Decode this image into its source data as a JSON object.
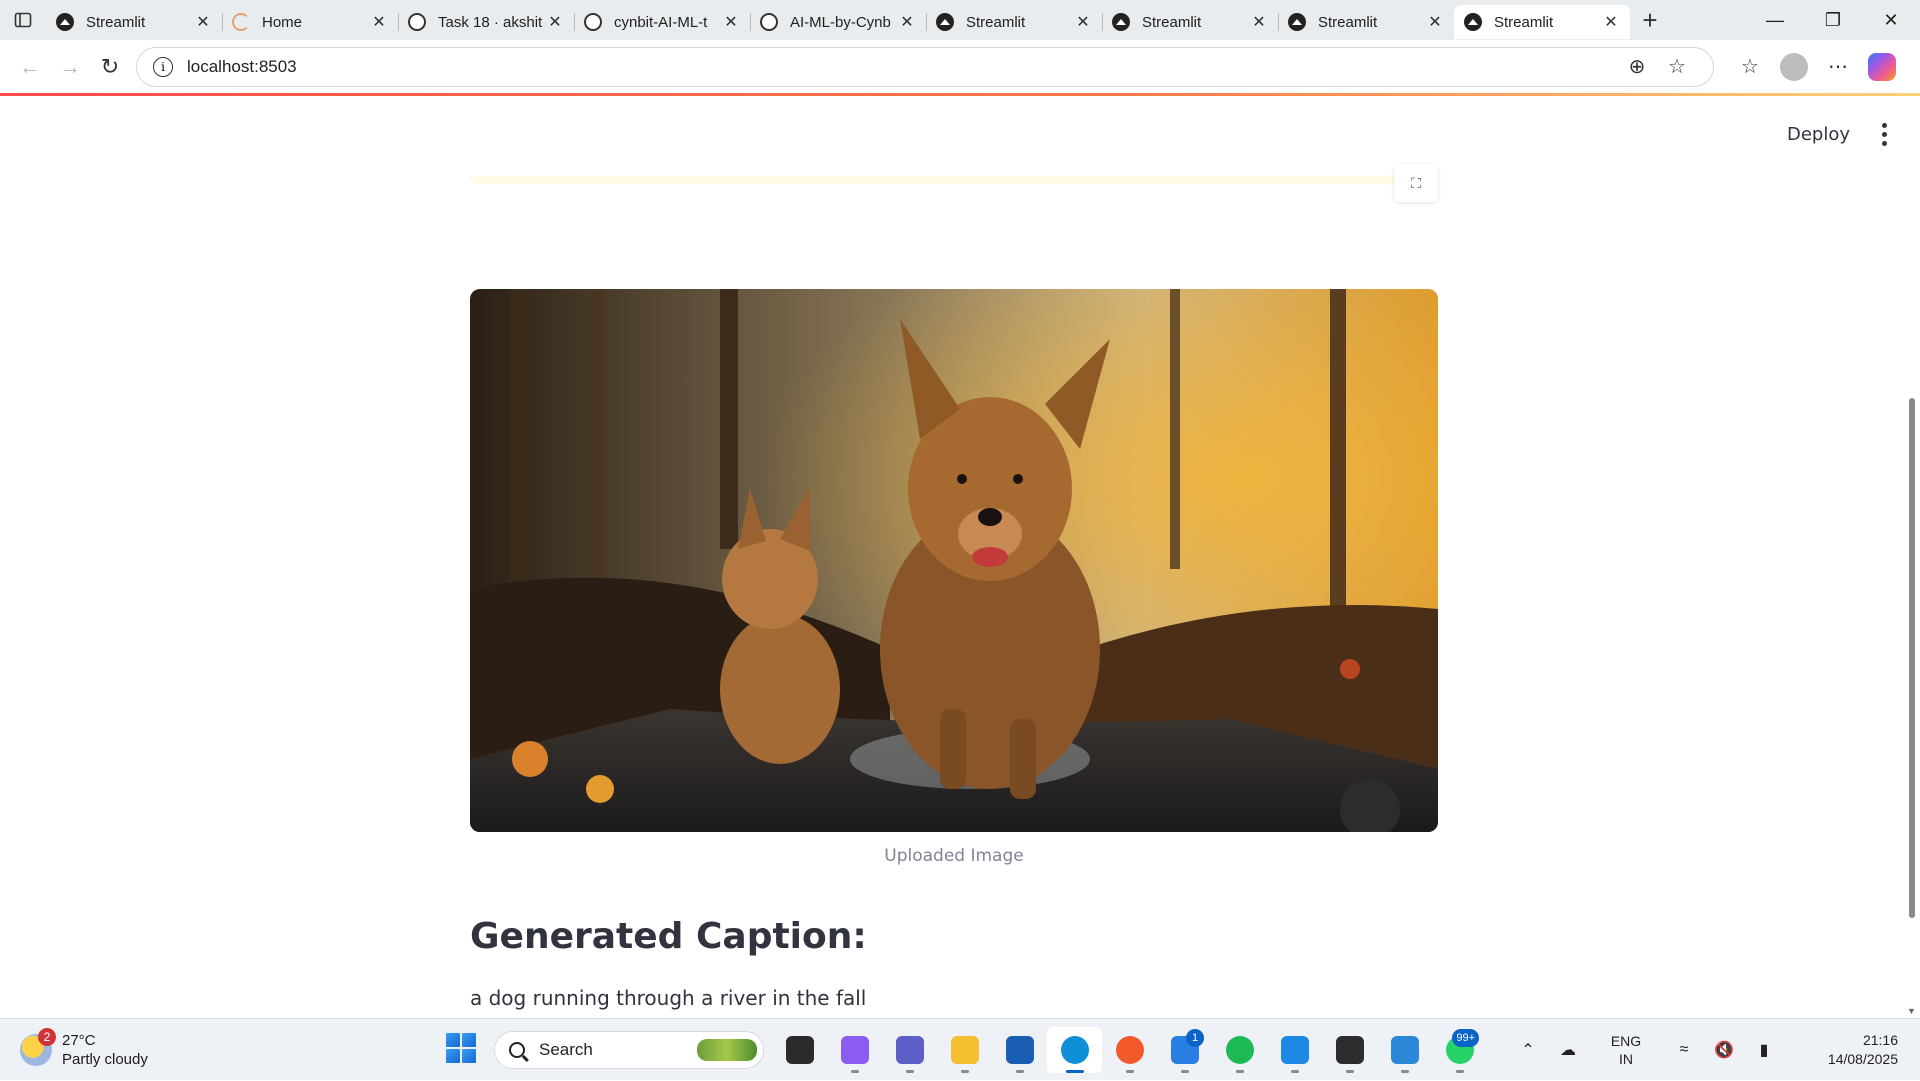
{
  "browser": {
    "tabs": [
      {
        "title": "Streamlit",
        "favicon": "streamlit-icon",
        "active": false
      },
      {
        "title": "Home",
        "favicon": "loading-spinner-icon",
        "active": false
      },
      {
        "title": "Task 18 · akshit",
        "favicon": "github-icon",
        "active": false
      },
      {
        "title": "cynbit-AI-ML-t",
        "favicon": "github-icon",
        "active": false
      },
      {
        "title": "AI-ML-by-Cynb",
        "favicon": "github-icon",
        "active": false
      },
      {
        "title": "Streamlit",
        "favicon": "streamlit-icon",
        "active": false
      },
      {
        "title": "Streamlit",
        "favicon": "streamlit-icon",
        "active": false
      },
      {
        "title": "Streamlit",
        "favicon": "streamlit-icon",
        "active": false
      },
      {
        "title": "Streamlit",
        "favicon": "streamlit-icon",
        "active": true
      }
    ],
    "url": "localhost:8503",
    "progress_color": "#ff4b4b"
  },
  "app": {
    "deploy_label": "Deploy",
    "image_caption": "Uploaded Image",
    "heading": "Generated Caption:",
    "caption_text": "a dog running through a river in the fall",
    "text_color": "#31333f"
  },
  "taskbar": {
    "weather": {
      "badge": "2",
      "temp": "27°C",
      "condition": "Partly cloudy"
    },
    "search_placeholder": "Search",
    "apps": [
      {
        "name": "task-view-icon",
        "color": "#2b2b2b",
        "badge": ""
      },
      {
        "name": "copilot-icon",
        "color": "#8a5cf0",
        "badge": ""
      },
      {
        "name": "teams-icon",
        "color": "#5b5fc7",
        "badge": ""
      },
      {
        "name": "file-explorer-icon",
        "color": "#f4c030",
        "badge": ""
      },
      {
        "name": "store-icon",
        "color": "#1a5fb4",
        "badge": ""
      },
      {
        "name": "edge-icon",
        "color": "#0f8fd8",
        "badge": "",
        "active": true
      },
      {
        "name": "brave-icon",
        "color": "#f25a2b",
        "badge": ""
      },
      {
        "name": "todo-icon",
        "color": "#2a7de1",
        "badge": "1"
      },
      {
        "name": "spotify-icon",
        "color": "#1db954",
        "badge": ""
      },
      {
        "name": "vscode-icon",
        "color": "#1e88e5",
        "badge": ""
      },
      {
        "name": "terminal-icon",
        "color": "#2d2d2d",
        "badge": ""
      },
      {
        "name": "photos-icon",
        "color": "#2b88d8",
        "badge": ""
      },
      {
        "name": "whatsapp-icon",
        "color": "#25d366",
        "badge": "99+"
      }
    ],
    "lang_line1": "ENG",
    "lang_line2": "IN",
    "time": "21:16",
    "date": "14/08/2025"
  }
}
